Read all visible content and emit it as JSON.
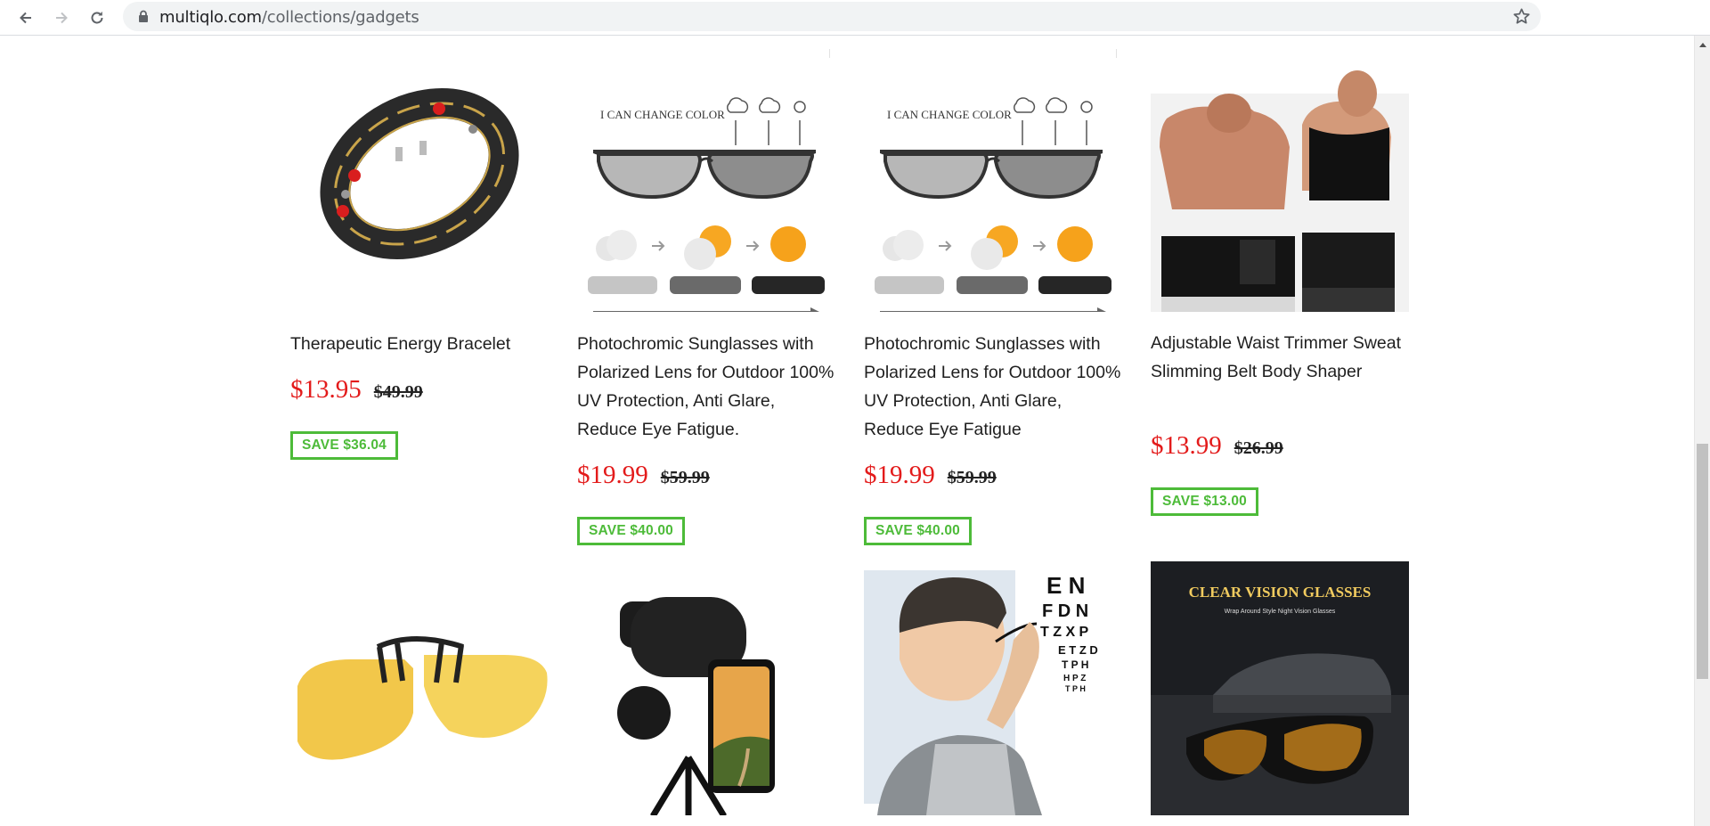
{
  "browser": {
    "url_host": "multiqlo.com",
    "url_path": "/collections/gadgets"
  },
  "products": [
    {
      "title": "Therapeutic Energy Bracelet",
      "price": "$13.95",
      "compare_price": "$49.99",
      "save_label": "SAVE $36.04",
      "image": "magnetic-bracelet"
    },
    {
      "title": "Photochromic Sunglasses with Polarized Lens for Outdoor 100% UV Protection, Anti Glare, Reduce Eye Fatigue.",
      "price": "$19.99",
      "compare_price": "$59.99",
      "save_label": "SAVE $40.00",
      "image": "photochromic-sunglasses",
      "image_text": "I CAN CHANGE COLOR"
    },
    {
      "title": "Photochromic Sunglasses with Polarized Lens for Outdoor 100% UV Protection, Anti Glare, Reduce Eye Fatigue",
      "price": "$19.99",
      "compare_price": "$59.99",
      "save_label": "SAVE $40.00",
      "image": "photochromic-sunglasses",
      "image_text": "I CAN CHANGE COLOR"
    },
    {
      "title": "Adjustable Waist Trimmer Sweat Slimming Belt Body Shaper",
      "price": "$13.99",
      "compare_price": "$26.99",
      "save_label": "SAVE $13.00",
      "image": "waist-trimmer-belt"
    },
    {
      "image": "clip-on-yellow-lenses"
    },
    {
      "image": "monocular-phone-telescope"
    },
    {
      "image": "eye-chart-glasses",
      "image_text": [
        "E N",
        "F D N",
        "T Z X P",
        "E T Z D",
        "T P H",
        "H P Z",
        "T P H"
      ]
    },
    {
      "image": "night-vision-glasses",
      "image_text": "CLEAR VISION GLASSES",
      "image_subtext": "Wrap Around Style Night Vision Glasses"
    }
  ],
  "colors": {
    "price_red": "#e31b1b",
    "save_green": "#4dbb39"
  }
}
